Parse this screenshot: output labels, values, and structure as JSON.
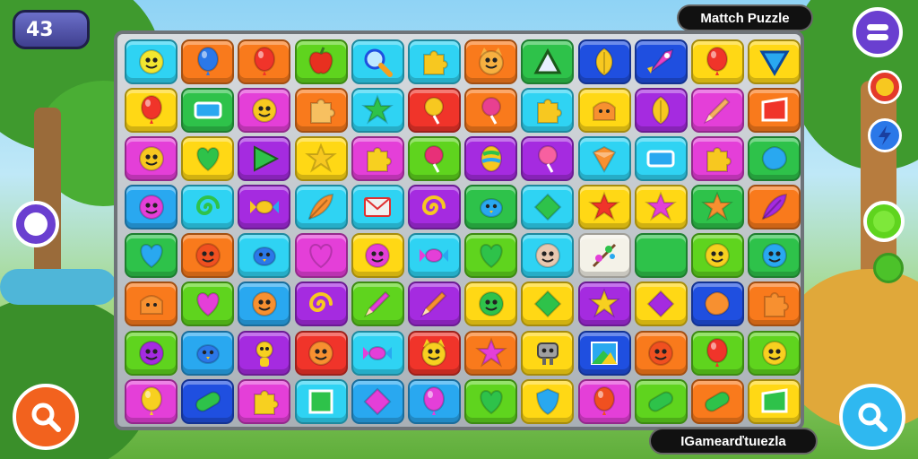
{
  "hud": {
    "score": "43",
    "title": "Mattch Puzzle",
    "footer_label": "IGamеarďtuιezla"
  },
  "colors": {
    "orange": "#f97a1c",
    "yellow": "#ffd815",
    "lime": "#5fd41e",
    "green": "#2ec24a",
    "cyan": "#2fd3f3",
    "sky": "#29a8f0",
    "blue": "#1f4fe0",
    "purple": "#a52be0",
    "magenta": "#e43fd8",
    "red": "#f0342a",
    "pale": "#f4f2e8"
  },
  "board": {
    "rows": [
      [
        {
          "color": "cyan",
          "icon": "face-icon",
          "ic": "#f2e630"
        },
        {
          "color": "orange",
          "icon": "balloon-icon",
          "ic": "#2b78e8"
        },
        {
          "color": "orange",
          "icon": "balloon-icon",
          "ic": "#f0342a"
        },
        {
          "color": "lime",
          "icon": "apple-icon",
          "ic": "#e83020"
        },
        {
          "color": "cyan",
          "icon": "magnifier-icon",
          "ic": "#f7a020"
        },
        {
          "color": "cyan",
          "icon": "puzzle-piece-icon",
          "ic": "#f7c820"
        },
        {
          "color": "orange",
          "icon": "cat-face-icon",
          "ic": "#f7b040"
        },
        {
          "color": "green",
          "icon": "triangle-icon",
          "ic": "#e8f0ff"
        },
        {
          "color": "blue",
          "icon": "leaf-icon",
          "ic": "#f7c820"
        },
        {
          "color": "blue",
          "icon": "rocket-icon",
          "ic": "#e840c8"
        },
        {
          "color": "yellow",
          "icon": "balloon-icon",
          "ic": "#f0342a"
        },
        {
          "color": "yellow",
          "icon": "down-triangle-icon",
          "ic": "#29a8f0"
        }
      ],
      [
        {
          "color": "yellow",
          "icon": "balloon-icon",
          "ic": "#f0342a"
        },
        {
          "color": "green",
          "icon": "rectangle-icon",
          "ic": "#29a8f0"
        },
        {
          "color": "magenta",
          "icon": "face-icon",
          "ic": "#f7c820"
        },
        {
          "color": "orange",
          "icon": "puzzle-piece-icon",
          "ic": "#f7c060"
        },
        {
          "color": "cyan",
          "icon": "star-icon",
          "ic": "#2ec24a"
        },
        {
          "color": "red",
          "icon": "lollipop-icon",
          "ic": "#f7c820"
        },
        {
          "color": "orange",
          "icon": "lollipop-icon",
          "ic": "#e84090"
        },
        {
          "color": "cyan",
          "icon": "puzzle-piece-icon",
          "ic": "#f7c820"
        },
        {
          "color": "yellow",
          "icon": "cake-icon",
          "ic": "#f79030"
        },
        {
          "color": "purple",
          "icon": "leaf-icon",
          "ic": "#f7c820"
        },
        {
          "color": "magenta",
          "icon": "pencil-icon",
          "ic": "#f7b060"
        },
        {
          "color": "orange",
          "icon": "flag-icon",
          "ic": "#f0342a"
        }
      ],
      [
        {
          "color": "magenta",
          "icon": "face-icon",
          "ic": "#f7c820"
        },
        {
          "color": "yellow",
          "icon": "heart-icon",
          "ic": "#2ec24a"
        },
        {
          "color": "purple",
          "icon": "play-icon",
          "ic": "#2ec24a"
        },
        {
          "color": "yellow",
          "icon": "star-icon",
          "ic": "#f7c820"
        },
        {
          "color": "magenta",
          "icon": "puzzle-piece-icon",
          "ic": "#f7d020"
        },
        {
          "color": "lime",
          "icon": "lollipop-icon",
          "ic": "#e83078"
        },
        {
          "color": "purple",
          "icon": "egg-icon",
          "ic": "#f7c820"
        },
        {
          "color": "purple",
          "icon": "lollipop-icon",
          "ic": "#f760a0"
        },
        {
          "color": "cyan",
          "icon": "gem-icon",
          "ic": "#f79030"
        },
        {
          "color": "cyan",
          "icon": "rectangle-icon",
          "ic": "#29a8f0"
        },
        {
          "color": "magenta",
          "icon": "puzzle-piece-icon",
          "ic": "#f7c820"
        },
        {
          "color": "green",
          "icon": "blob-icon",
          "ic": "#29a8f0"
        }
      ],
      [
        {
          "color": "sky",
          "icon": "face-icon",
          "ic": "#e43fd8"
        },
        {
          "color": "cyan",
          "icon": "swirl-icon",
          "ic": "#2ec24a"
        },
        {
          "color": "purple",
          "icon": "candy-icon",
          "ic": "#f7c820"
        },
        {
          "color": "cyan",
          "icon": "feather-icon",
          "ic": "#f79030"
        },
        {
          "color": "cyan",
          "icon": "envelope-icon",
          "ic": "#f0f0f0"
        },
        {
          "color": "purple",
          "icon": "swirl-icon",
          "ic": "#f7c820"
        },
        {
          "color": "green",
          "icon": "bird-icon",
          "ic": "#29a8f0"
        },
        {
          "color": "cyan",
          "icon": "diamond-icon",
          "ic": "#2ec24a"
        },
        {
          "color": "yellow",
          "icon": "star-icon",
          "ic": "#f0342a"
        },
        {
          "color": "yellow",
          "icon": "star-icon",
          "ic": "#e43fd8"
        },
        {
          "color": "green",
          "icon": "star-icon",
          "ic": "#f79030"
        },
        {
          "color": "orange",
          "icon": "feather-icon",
          "ic": "#a52be0"
        }
      ],
      [
        {
          "color": "green",
          "icon": "heart-icon",
          "ic": "#29a8f0"
        },
        {
          "color": "orange",
          "icon": "face-icon",
          "ic": "#f05020"
        },
        {
          "color": "cyan",
          "icon": "bird-icon",
          "ic": "#2b78e8"
        },
        {
          "color": "magenta",
          "icon": "heart-icon",
          "ic": "#e43fd8"
        },
        {
          "color": "yellow",
          "icon": "face-icon",
          "ic": "#e43fd8"
        },
        {
          "color": "cyan",
          "icon": "candy-icon",
          "ic": "#e43fd8"
        },
        {
          "color": "lime",
          "icon": "heart-icon",
          "ic": "#2ec24a"
        },
        {
          "color": "cyan",
          "icon": "face-icon",
          "ic": "#e8c8b0"
        },
        {
          "color": "pale",
          "icon": "branch-icon",
          "ic": "#2ec24a"
        },
        {
          "color": "green",
          "icon": "swirl-icon",
          "ic": "#2ec24a"
        },
        {
          "color": "lime",
          "icon": "face-icon",
          "ic": "#f7d020"
        },
        {
          "color": "green",
          "icon": "face-icon",
          "ic": "#29a8f0"
        }
      ],
      [
        {
          "color": "orange",
          "icon": "cake-icon",
          "ic": "#f79030"
        },
        {
          "color": "lime",
          "icon": "heart-icon",
          "ic": "#e43fd8"
        },
        {
          "color": "sky",
          "icon": "face-icon",
          "ic": "#f79030"
        },
        {
          "color": "purple",
          "icon": "swirl-icon",
          "ic": "#f7c820"
        },
        {
          "color": "lime",
          "icon": "pencil-icon",
          "ic": "#e43fd8"
        },
        {
          "color": "purple",
          "icon": "pencil-icon",
          "ic": "#f79030"
        },
        {
          "color": "yellow",
          "icon": "face-icon",
          "ic": "#2ec24a"
        },
        {
          "color": "yellow",
          "icon": "diamond-icon",
          "ic": "#2ec24a"
        },
        {
          "color": "purple",
          "icon": "star-icon",
          "ic": "#f7d020"
        },
        {
          "color": "yellow",
          "icon": "diamond-icon",
          "ic": "#a52be0"
        },
        {
          "color": "blue",
          "icon": "blob-icon",
          "ic": "#f79030"
        },
        {
          "color": "orange",
          "icon": "puzzle-piece-icon",
          "ic": "#f79030"
        }
      ],
      [
        {
          "color": "lime",
          "icon": "face-icon",
          "ic": "#a52be0"
        },
        {
          "color": "sky",
          "icon": "bird-icon",
          "ic": "#2b78e8"
        },
        {
          "color": "purple",
          "icon": "monkey-icon",
          "ic": "#f7d020"
        },
        {
          "color": "red",
          "icon": "face-icon",
          "ic": "#f79030"
        },
        {
          "color": "cyan",
          "icon": "candy-icon",
          "ic": "#e43fd8"
        },
        {
          "color": "red",
          "icon": "cat-face-icon",
          "ic": "#f7d020"
        },
        {
          "color": "orange",
          "icon": "star-icon",
          "ic": "#e43fd8"
        },
        {
          "color": "yellow",
          "icon": "robot-icon",
          "ic": "#a0a0a0"
        },
        {
          "color": "blue",
          "icon": "picture-icon",
          "ic": "#f7d020"
        },
        {
          "color": "orange",
          "icon": "face-icon",
          "ic": "#f05020"
        },
        {
          "color": "lime",
          "icon": "balloon-icon",
          "ic": "#f0342a"
        },
        {
          "color": "lime",
          "icon": "face-icon",
          "ic": "#f7d020"
        }
      ],
      [
        {
          "color": "magenta",
          "icon": "balloon-icon",
          "ic": "#f7d020"
        },
        {
          "color": "blue",
          "icon": "pill-icon",
          "ic": "#2ec24a"
        },
        {
          "color": "magenta",
          "icon": "puzzle-piece-icon",
          "ic": "#f7d020"
        },
        {
          "color": "cyan",
          "icon": "square-icon",
          "ic": "#2ec24a"
        },
        {
          "color": "sky",
          "icon": "diamond-icon",
          "ic": "#e43fd8"
        },
        {
          "color": "sky",
          "icon": "balloon-icon",
          "ic": "#e43fd8"
        },
        {
          "color": "lime",
          "icon": "heart-icon",
          "ic": "#2ec24a"
        },
        {
          "color": "yellow",
          "icon": "shield-icon",
          "ic": "#29a8f0"
        },
        {
          "color": "magenta",
          "icon": "balloon-icon",
          "ic": "#f05020"
        },
        {
          "color": "lime",
          "icon": "pill-icon",
          "ic": "#2ec24a"
        },
        {
          "color": "orange",
          "icon": "pill-icon",
          "ic": "#2ec24a"
        },
        {
          "color": "yellow",
          "icon": "flag-icon",
          "ic": "#2ec24a"
        }
      ]
    ]
  },
  "side_buttons": [
    {
      "name": "menu-button",
      "icon": "menu-icon"
    },
    {
      "name": "left-ring-button",
      "icon": "ring-icon"
    },
    {
      "name": "hint-coin-button",
      "icon": "coin-icon"
    },
    {
      "name": "lightning-coin-button",
      "icon": "lightning-icon"
    },
    {
      "name": "green-status-button",
      "icon": "circle-icon"
    },
    {
      "name": "search-left-button",
      "icon": "search-icon"
    },
    {
      "name": "search-right-button",
      "icon": "search-icon"
    }
  ]
}
